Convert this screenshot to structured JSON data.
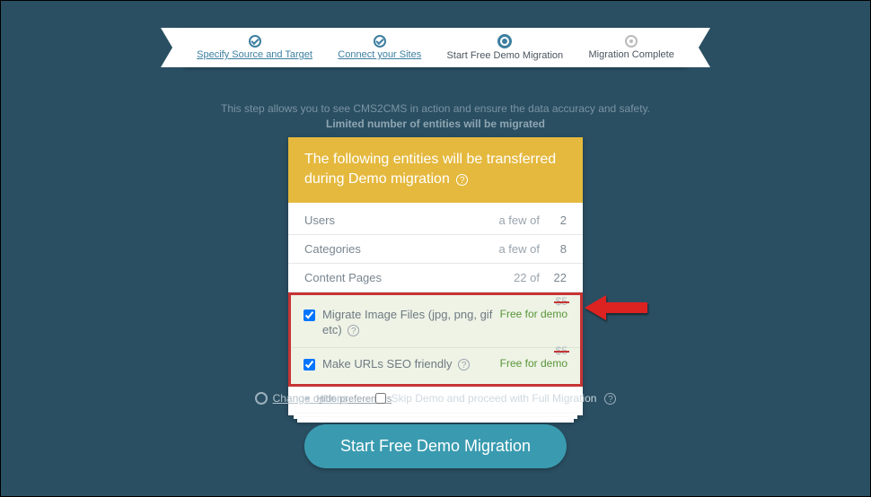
{
  "steps": [
    {
      "label": "Specify Source and Target",
      "state": "done",
      "link": true
    },
    {
      "label": "Connect your Sites",
      "state": "done",
      "link": true
    },
    {
      "label": "Start Free Demo Migration",
      "state": "current",
      "link": false
    },
    {
      "label": "Migration Complete",
      "state": "pending",
      "link": false
    }
  ],
  "intro": {
    "line1": "This step allows you to see CMS2CMS in action and ensure the data accuracy and safety.",
    "line2": "Limited number of entities will be migrated"
  },
  "card": {
    "title": "The following entities will be transferred during Demo migration",
    "rows": [
      {
        "label": "Users",
        "qualifier": "a few of",
        "count": "2"
      },
      {
        "label": "Categories",
        "qualifier": "a few of",
        "count": "8"
      },
      {
        "label": "Content Pages",
        "qualifier": "22 of",
        "count": "22"
      }
    ],
    "options": [
      {
        "label": "Migrate Image Files (jpg, png, gif etc)",
        "old_price": "$5",
        "price": "Free for demo",
        "help": true
      },
      {
        "label": "Make URLs SEO friendly",
        "old_price": "$5",
        "price": "Free for demo",
        "help": true
      }
    ],
    "hide_preferences": "Hide preferences"
  },
  "controls": {
    "change_options": "Change options",
    "skip_demo": "Skip Demo and proceed with Full Migration"
  },
  "cta": "Start Free Demo Migration"
}
